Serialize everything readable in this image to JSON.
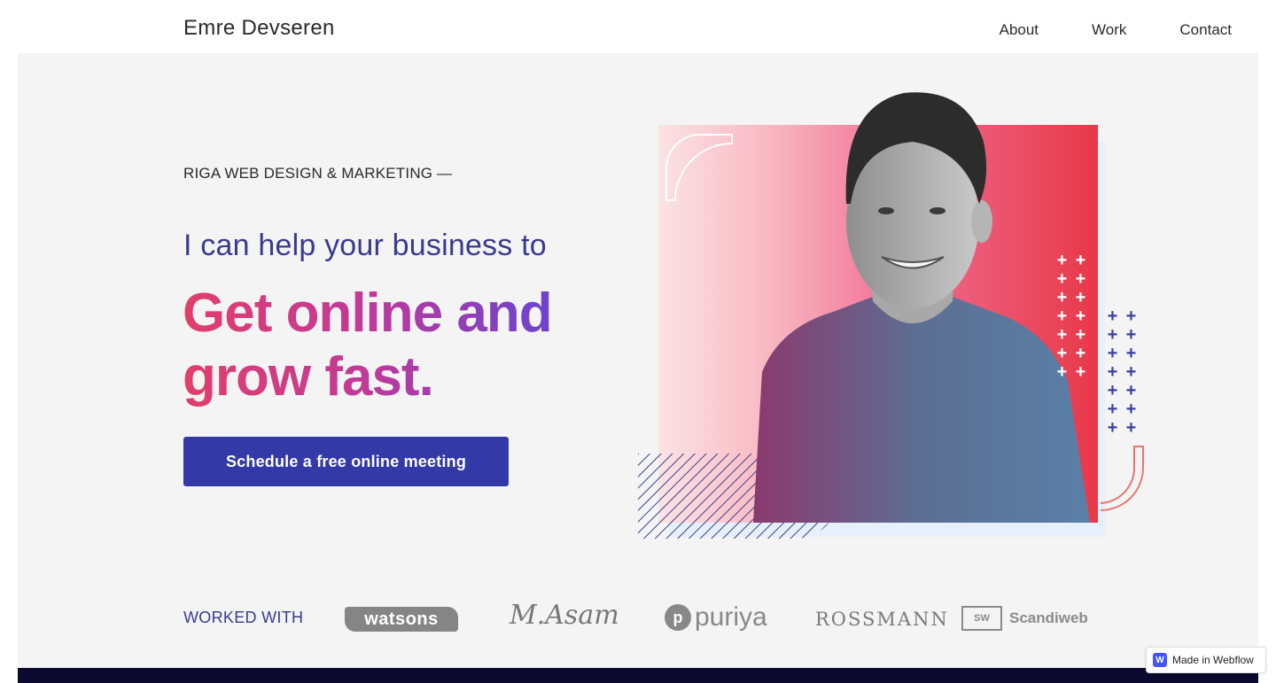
{
  "header": {
    "brand": "Emre Devseren",
    "nav": [
      {
        "label": "About"
      },
      {
        "label": "Work"
      },
      {
        "label": "Contact"
      }
    ]
  },
  "hero": {
    "eyebrow": "RIGA WEB DESIGN & MARKETING —",
    "lead": "I can help your business to",
    "headline": "Get online and grow fast.",
    "cta_label": "Schedule a free online meeting"
  },
  "clients": {
    "label": "WORKED WITH",
    "logos": [
      {
        "name": "watsons"
      },
      {
        "name": "M.Asam"
      },
      {
        "name": "puriya"
      },
      {
        "name": "ROSSMANN"
      },
      {
        "name": "Scandiweb"
      }
    ]
  },
  "badge": {
    "label": "Made in Webflow"
  },
  "colors": {
    "primary": "#3439a8",
    "accent_pink": "#e23e6b",
    "accent_purple": "#5a45dd",
    "panel_bg": "#f4f4f5",
    "footer_dark": "#0b0a2e"
  },
  "icons": {
    "plus": "plus-icon",
    "webflow": "webflow-icon"
  }
}
